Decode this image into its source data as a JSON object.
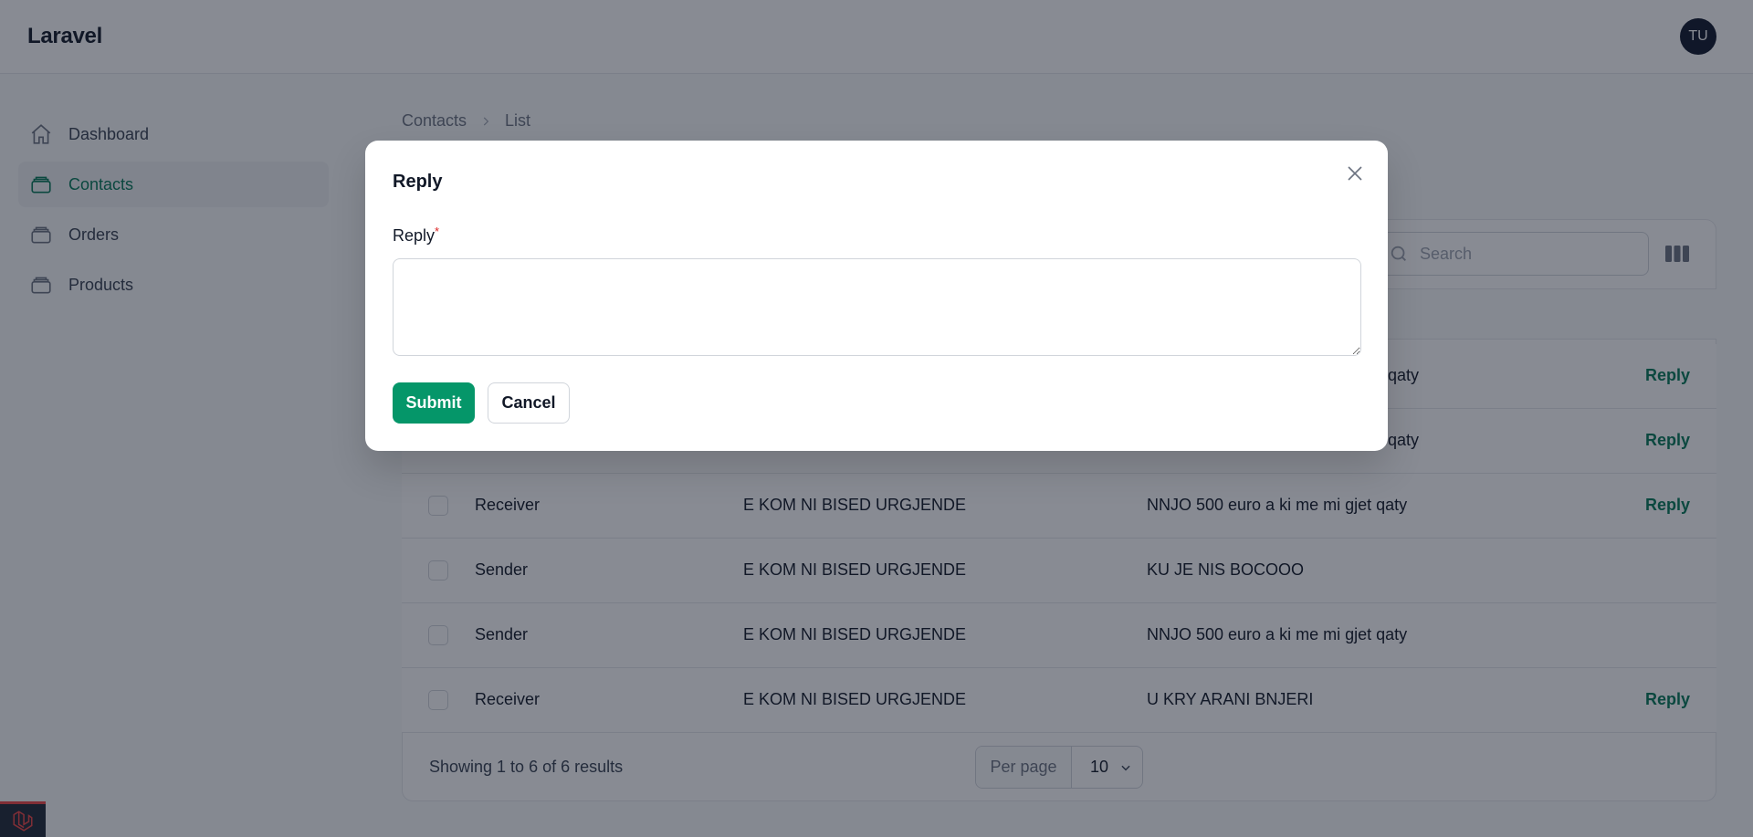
{
  "app": {
    "brand": "Laravel",
    "avatar_initials": "TU"
  },
  "sidebar": {
    "items": [
      {
        "label": "Dashboard",
        "icon": "home-icon",
        "active": false
      },
      {
        "label": "Contacts",
        "icon": "stack-icon",
        "active": true
      },
      {
        "label": "Orders",
        "icon": "stack-icon",
        "active": false
      },
      {
        "label": "Products",
        "icon": "stack-icon",
        "active": false
      }
    ]
  },
  "breadcrumb": {
    "parent": "Contacts",
    "current": "List"
  },
  "table": {
    "search_placeholder": "Search",
    "rows": [
      {
        "col1": "",
        "col2": "",
        "col3": "qaty",
        "action": "Reply"
      },
      {
        "col1": "",
        "col2": "",
        "col3": "qaty",
        "action": "Reply"
      },
      {
        "col1": "Receiver",
        "col2": "E KOM NI BISED URGJENDE",
        "col3": "NNJO 500 euro a ki me mi gjet qaty",
        "action": "Reply"
      },
      {
        "col1": "Sender",
        "col2": "E KOM NI BISED URGJENDE",
        "col3": "KU JE NIS BOCOOO",
        "action": ""
      },
      {
        "col1": "Sender",
        "col2": "E KOM NI BISED URGJENDE",
        "col3": "NNJO 500 euro a ki me mi gjet qaty",
        "action": ""
      },
      {
        "col1": "Receiver",
        "col2": "E KOM NI BISED URGJENDE",
        "col3": "U KRY ARANI BNJERI",
        "action": "Reply"
      }
    ],
    "footer": {
      "summary": "Showing 1 to 6 of 6 results",
      "per_page_label": "Per page",
      "per_page_value": "10"
    }
  },
  "modal": {
    "title": "Reply",
    "field_label": "Reply",
    "required_marker": "*",
    "textarea_value": "",
    "submit_label": "Submit",
    "cancel_label": "Cancel"
  },
  "colors": {
    "accent": "#059669",
    "accent_text": "#047857",
    "overlay": "rgba(17,24,39,0.5)"
  }
}
